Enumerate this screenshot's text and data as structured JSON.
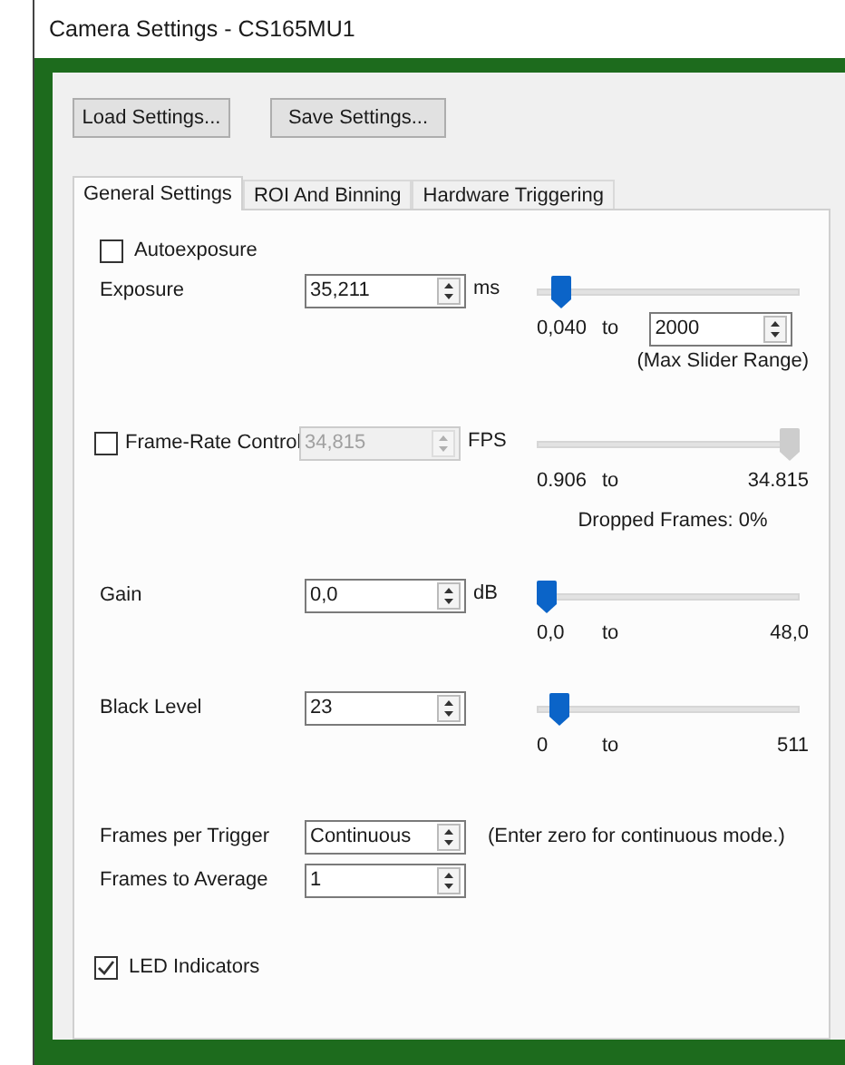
{
  "window": {
    "title": "Camera Settings - CS165MU1"
  },
  "buttons": [
    "Load Settings...",
    "Save Settings..."
  ],
  "tabs": [
    {
      "label": "General Settings",
      "selected": true
    },
    {
      "label": "ROI And Binning",
      "selected": false
    },
    {
      "label": "Hardware Triggering",
      "selected": false
    }
  ],
  "autoexposure": {
    "label": "Autoexposure",
    "checked": false
  },
  "settings": [
    {
      "kind": "exposure",
      "label": "Exposure",
      "value": "35,211",
      "unit": "ms",
      "disabled": false,
      "level": 0.06,
      "min": "0,040",
      "to": "to",
      "max_field": "2000",
      "note": "(Max Slider Range)"
    },
    {
      "kind": "framerate",
      "label": "Frame-Rate Control",
      "checked": false,
      "value": "34,815",
      "unit": "FPS",
      "disabled": true,
      "level": 1,
      "min": "0.906",
      "to": "to",
      "max": "34.815",
      "note": "Dropped Frames: 0%"
    },
    {
      "kind": "gain",
      "label": "Gain",
      "value": "0,0",
      "unit": "dB",
      "disabled": false,
      "level": 0,
      "min": "0,0",
      "to": "to",
      "max": "48,0"
    },
    {
      "kind": "black",
      "label": "Black Level",
      "value": "23",
      "disabled": false,
      "level": 0.05,
      "min": "0",
      "to": "to",
      "max": "511"
    }
  ],
  "trigger_rows": [
    {
      "label": "Frames per Trigger",
      "value": "Continuous",
      "hint": "(Enter zero for continuous mode.)"
    },
    {
      "label": "Frames to Average",
      "value": "1"
    }
  ],
  "led": {
    "label": "LED Indicators",
    "checked": true
  }
}
